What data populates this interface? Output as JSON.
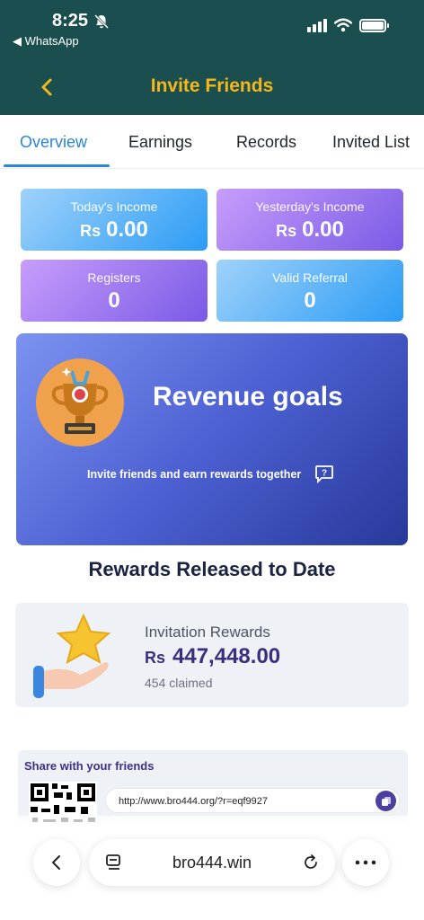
{
  "status": {
    "time": "8:25",
    "back_app": "◀ WhatsApp"
  },
  "header": {
    "title": "Invite Friends"
  },
  "tabs": [
    {
      "label": "Overview",
      "active": true
    },
    {
      "label": "Earnings",
      "active": false
    },
    {
      "label": "Records",
      "active": false
    },
    {
      "label": "Invited List",
      "active": false
    }
  ],
  "stats": {
    "currency": "Rs",
    "today": {
      "label": "Today's Income",
      "value": "0.00"
    },
    "yesterday": {
      "label": "Yesterday's Income",
      "value": "0.00"
    },
    "registers": {
      "label": "Registers",
      "value": "0"
    },
    "valid": {
      "label": "Valid Referral",
      "value": "0"
    }
  },
  "goal": {
    "title": "Revenue goals",
    "subtitle": "Invite friends and earn rewards together"
  },
  "released": {
    "heading": "Rewards Released to Date"
  },
  "reward": {
    "title": "Invitation Rewards",
    "currency": "Rs",
    "amount": "447,448.00",
    "claimed": "454 claimed"
  },
  "share": {
    "title": "Share with your friends",
    "link": "http://www.bro444.org/?r=eqf9927"
  },
  "browser": {
    "domain": "bro444.win"
  },
  "colors": {
    "header_bg": "#1b4e4e",
    "title": "#f5b81a",
    "accent": "#2a86d8",
    "reward_amount": "#3a2f7e"
  },
  "icons": [
    "back-chevron-icon",
    "mute-bell-icon",
    "signal-icon",
    "wifi-icon",
    "battery-icon",
    "trophy-icon",
    "help-icon",
    "star-hand-icon",
    "qr-code-icon",
    "copy-icon",
    "browser-back-icon",
    "tabs-icon",
    "reload-icon",
    "more-icon"
  ]
}
